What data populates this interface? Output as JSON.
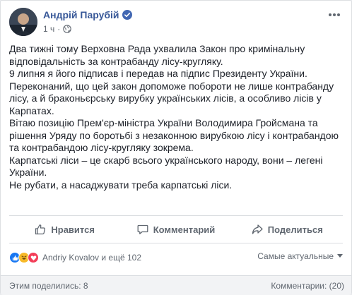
{
  "post": {
    "author": "Андрій Парубій",
    "time": "1 ч",
    "separator": "·",
    "paragraphs": [
      "Два тижні тому Верховна Рада ухвалила Закон про кримінальну відповідальність за контрабанду лісу-кругляку.",
      "9 липня я його підписав і передав на підпис Президенту України.",
      "Переконаний, що цей закон допоможе побороти не лише контрабанду лісу, а й браконьєрську вирубку українських лісів, а особливо лісів у Карпатах.",
      "Вітаю позицію Прем'єр-міністра України Володимира Гройсмана та рішення Уряду по боротьбі з незаконною вирубкою лісу і контрабандою та контрабандою лісу-кругляку зокрема.",
      "Карпатські ліси – це скарб всього українського народу, вони – легені України.",
      "Не рубати, а насаджувати треба карпатські ліси."
    ]
  },
  "actions": {
    "like": "Нравится",
    "comment": "Комментарий",
    "share": "Поделиться"
  },
  "reactions": {
    "summary": "Andriy Kovalov и ещё 102",
    "sort_label": "Самые актуальные"
  },
  "footer": {
    "shares": "Этим поделились: 8",
    "comments": "Комментарии: (20)"
  },
  "colors": {
    "link": "#385898",
    "like_blue": "#1877f2",
    "haha_yellow": "#f7b928",
    "love_red": "#f33e58"
  }
}
